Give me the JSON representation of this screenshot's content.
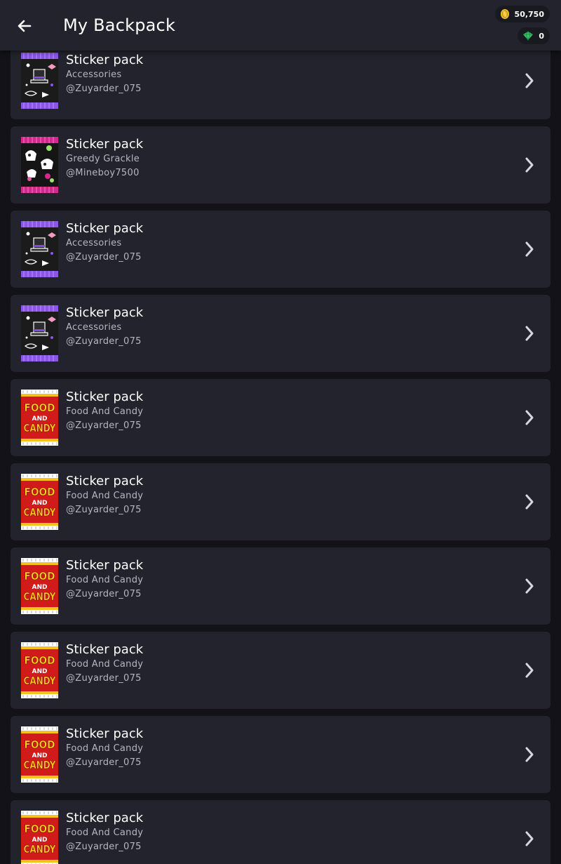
{
  "header": {
    "title": "My Backpack",
    "back_icon": "arrow-left-icon"
  },
  "currency": {
    "coins": {
      "icon": "coin-icon",
      "value": "50,750",
      "color": "#f4c430"
    },
    "gems": {
      "icon": "gem-icon",
      "value": "0",
      "color": "#3ec46d"
    }
  },
  "colors": {
    "background": "#121218",
    "card": "#23232d",
    "header": "#23232d"
  },
  "items": [
    {
      "name": "Sticker pack",
      "category": "Accessories",
      "owner": "@Zuyarder_075",
      "art": "accessories"
    },
    {
      "name": "Sticker pack",
      "category": "Greedy Grackle",
      "owner": "@Mineboy7500",
      "art": "greedy"
    },
    {
      "name": "Sticker pack",
      "category": "Accessories",
      "owner": "@Zuyarder_075",
      "art": "accessories"
    },
    {
      "name": "Sticker pack",
      "category": "Accessories",
      "owner": "@Zuyarder_075",
      "art": "accessories"
    },
    {
      "name": "Sticker pack",
      "category": "Food And Candy",
      "owner": "@Zuyarder_075",
      "art": "food"
    },
    {
      "name": "Sticker pack",
      "category": "Food And Candy",
      "owner": "@Zuyarder_075",
      "art": "food"
    },
    {
      "name": "Sticker pack",
      "category": "Food And Candy",
      "owner": "@Zuyarder_075",
      "art": "food"
    },
    {
      "name": "Sticker pack",
      "category": "Food And Candy",
      "owner": "@Zuyarder_075",
      "art": "food"
    },
    {
      "name": "Sticker pack",
      "category": "Food And Candy",
      "owner": "@Zuyarder_075",
      "art": "food"
    },
    {
      "name": "Sticker pack",
      "category": "Food And Candy",
      "owner": "@Zuyarder_075",
      "art": "food"
    }
  ],
  "pack_art": {
    "food": {
      "line1": "FOOD",
      "line2": "AND",
      "line3": "CANDY"
    }
  }
}
